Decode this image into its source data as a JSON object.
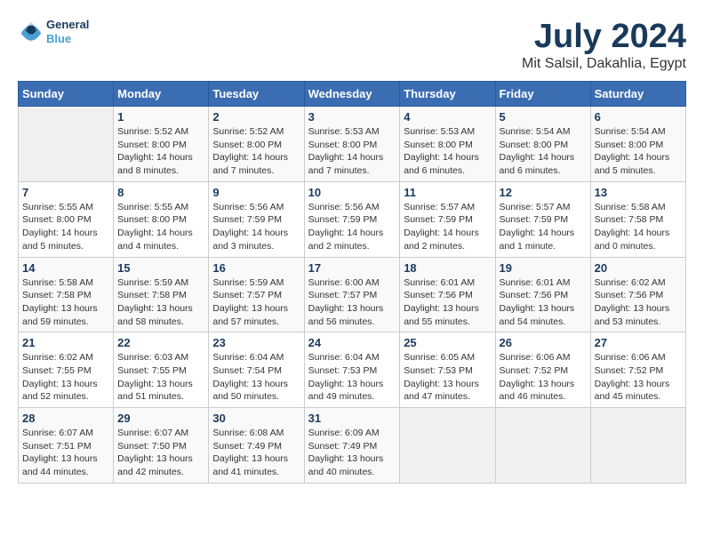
{
  "header": {
    "logo_line1": "General",
    "logo_line2": "Blue",
    "month_year": "July 2024",
    "location": "Mit Salsil, Dakahlia, Egypt"
  },
  "calendar": {
    "days_of_week": [
      "Sunday",
      "Monday",
      "Tuesday",
      "Wednesday",
      "Thursday",
      "Friday",
      "Saturday"
    ],
    "weeks": [
      [
        {
          "day": "",
          "info": ""
        },
        {
          "day": "1",
          "info": "Sunrise: 5:52 AM\nSunset: 8:00 PM\nDaylight: 14 hours\nand 8 minutes."
        },
        {
          "day": "2",
          "info": "Sunrise: 5:52 AM\nSunset: 8:00 PM\nDaylight: 14 hours\nand 7 minutes."
        },
        {
          "day": "3",
          "info": "Sunrise: 5:53 AM\nSunset: 8:00 PM\nDaylight: 14 hours\nand 7 minutes."
        },
        {
          "day": "4",
          "info": "Sunrise: 5:53 AM\nSunset: 8:00 PM\nDaylight: 14 hours\nand 6 minutes."
        },
        {
          "day": "5",
          "info": "Sunrise: 5:54 AM\nSunset: 8:00 PM\nDaylight: 14 hours\nand 6 minutes."
        },
        {
          "day": "6",
          "info": "Sunrise: 5:54 AM\nSunset: 8:00 PM\nDaylight: 14 hours\nand 5 minutes."
        }
      ],
      [
        {
          "day": "7",
          "info": "Sunrise: 5:55 AM\nSunset: 8:00 PM\nDaylight: 14 hours\nand 5 minutes."
        },
        {
          "day": "8",
          "info": "Sunrise: 5:55 AM\nSunset: 8:00 PM\nDaylight: 14 hours\nand 4 minutes."
        },
        {
          "day": "9",
          "info": "Sunrise: 5:56 AM\nSunset: 7:59 PM\nDaylight: 14 hours\nand 3 minutes."
        },
        {
          "day": "10",
          "info": "Sunrise: 5:56 AM\nSunset: 7:59 PM\nDaylight: 14 hours\nand 2 minutes."
        },
        {
          "day": "11",
          "info": "Sunrise: 5:57 AM\nSunset: 7:59 PM\nDaylight: 14 hours\nand 2 minutes."
        },
        {
          "day": "12",
          "info": "Sunrise: 5:57 AM\nSunset: 7:59 PM\nDaylight: 14 hours\nand 1 minute."
        },
        {
          "day": "13",
          "info": "Sunrise: 5:58 AM\nSunset: 7:58 PM\nDaylight: 14 hours\nand 0 minutes."
        }
      ],
      [
        {
          "day": "14",
          "info": "Sunrise: 5:58 AM\nSunset: 7:58 PM\nDaylight: 13 hours\nand 59 minutes."
        },
        {
          "day": "15",
          "info": "Sunrise: 5:59 AM\nSunset: 7:58 PM\nDaylight: 13 hours\nand 58 minutes."
        },
        {
          "day": "16",
          "info": "Sunrise: 5:59 AM\nSunset: 7:57 PM\nDaylight: 13 hours\nand 57 minutes."
        },
        {
          "day": "17",
          "info": "Sunrise: 6:00 AM\nSunset: 7:57 PM\nDaylight: 13 hours\nand 56 minutes."
        },
        {
          "day": "18",
          "info": "Sunrise: 6:01 AM\nSunset: 7:56 PM\nDaylight: 13 hours\nand 55 minutes."
        },
        {
          "day": "19",
          "info": "Sunrise: 6:01 AM\nSunset: 7:56 PM\nDaylight: 13 hours\nand 54 minutes."
        },
        {
          "day": "20",
          "info": "Sunrise: 6:02 AM\nSunset: 7:56 PM\nDaylight: 13 hours\nand 53 minutes."
        }
      ],
      [
        {
          "day": "21",
          "info": "Sunrise: 6:02 AM\nSunset: 7:55 PM\nDaylight: 13 hours\nand 52 minutes."
        },
        {
          "day": "22",
          "info": "Sunrise: 6:03 AM\nSunset: 7:55 PM\nDaylight: 13 hours\nand 51 minutes."
        },
        {
          "day": "23",
          "info": "Sunrise: 6:04 AM\nSunset: 7:54 PM\nDaylight: 13 hours\nand 50 minutes."
        },
        {
          "day": "24",
          "info": "Sunrise: 6:04 AM\nSunset: 7:53 PM\nDaylight: 13 hours\nand 49 minutes."
        },
        {
          "day": "25",
          "info": "Sunrise: 6:05 AM\nSunset: 7:53 PM\nDaylight: 13 hours\nand 47 minutes."
        },
        {
          "day": "26",
          "info": "Sunrise: 6:06 AM\nSunset: 7:52 PM\nDaylight: 13 hours\nand 46 minutes."
        },
        {
          "day": "27",
          "info": "Sunrise: 6:06 AM\nSunset: 7:52 PM\nDaylight: 13 hours\nand 45 minutes."
        }
      ],
      [
        {
          "day": "28",
          "info": "Sunrise: 6:07 AM\nSunset: 7:51 PM\nDaylight: 13 hours\nand 44 minutes."
        },
        {
          "day": "29",
          "info": "Sunrise: 6:07 AM\nSunset: 7:50 PM\nDaylight: 13 hours\nand 42 minutes."
        },
        {
          "day": "30",
          "info": "Sunrise: 6:08 AM\nSunset: 7:49 PM\nDaylight: 13 hours\nand 41 minutes."
        },
        {
          "day": "31",
          "info": "Sunrise: 6:09 AM\nSunset: 7:49 PM\nDaylight: 13 hours\nand 40 minutes."
        },
        {
          "day": "",
          "info": ""
        },
        {
          "day": "",
          "info": ""
        },
        {
          "day": "",
          "info": ""
        }
      ]
    ]
  }
}
